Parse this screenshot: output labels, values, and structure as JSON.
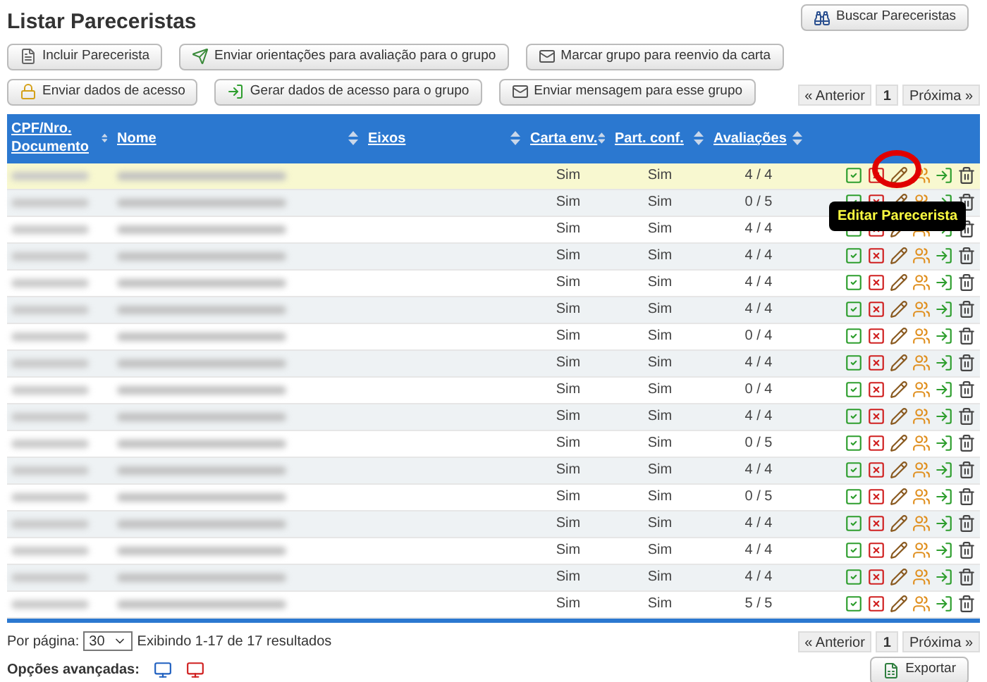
{
  "title": "Listar Pareceristas",
  "search_button": "Buscar Pareceristas",
  "toolbar_rows": [
    [
      {
        "label": "Incluir Parecerista",
        "kind": "page"
      },
      {
        "label": "Enviar orientações para avaliação para o grupo",
        "kind": "send"
      },
      {
        "label": "Marcar grupo para reenvio da carta",
        "kind": "mail"
      }
    ],
    [
      {
        "label": "Enviar dados de acesso",
        "kind": "lock"
      },
      {
        "label": "Gerar dados de acesso para o grupo",
        "kind": "arrow"
      },
      {
        "label": "Enviar mensagem para esse grupo",
        "kind": "mail"
      }
    ]
  ],
  "pagination_top": {
    "prev": "« Anterior",
    "page": "1",
    "next": "Próxima »"
  },
  "table": {
    "columns": [
      {
        "label": "CPF/Nro. Documento"
      },
      {
        "label": "Nome"
      },
      {
        "label": "Eixos"
      },
      {
        "label": "Carta env."
      },
      {
        "label": "Part. conf."
      },
      {
        "label": "Avaliações"
      }
    ],
    "rows": [
      {
        "carta": "Sim",
        "part": "Sim",
        "avaliacoes": "4 / 4",
        "selected": true
      },
      {
        "carta": "Sim",
        "part": "Sim",
        "avaliacoes": "0 / 5",
        "selected": false
      },
      {
        "carta": "Sim",
        "part": "Sim",
        "avaliacoes": "4 / 4",
        "selected": false
      },
      {
        "carta": "Sim",
        "part": "Sim",
        "avaliacoes": "4 / 4",
        "selected": false
      },
      {
        "carta": "Sim",
        "part": "Sim",
        "avaliacoes": "4 / 4",
        "selected": false
      },
      {
        "carta": "Sim",
        "part": "Sim",
        "avaliacoes": "4 / 4",
        "selected": false
      },
      {
        "carta": "Sim",
        "part": "Sim",
        "avaliacoes": "0 / 4",
        "selected": false
      },
      {
        "carta": "Sim",
        "part": "Sim",
        "avaliacoes": "4 / 4",
        "selected": false
      },
      {
        "carta": "Sim",
        "part": "Sim",
        "avaliacoes": "0 / 4",
        "selected": false
      },
      {
        "carta": "Sim",
        "part": "Sim",
        "avaliacoes": "4 / 4",
        "selected": false
      },
      {
        "carta": "Sim",
        "part": "Sim",
        "avaliacoes": "0 / 5",
        "selected": false
      },
      {
        "carta": "Sim",
        "part": "Sim",
        "avaliacoes": "4 / 4",
        "selected": false
      },
      {
        "carta": "Sim",
        "part": "Sim",
        "avaliacoes": "0 / 5",
        "selected": false
      },
      {
        "carta": "Sim",
        "part": "Sim",
        "avaliacoes": "4 / 4",
        "selected": false
      },
      {
        "carta": "Sim",
        "part": "Sim",
        "avaliacoes": "4 / 4",
        "selected": false
      },
      {
        "carta": "Sim",
        "part": "Sim",
        "avaliacoes": "4 / 4",
        "selected": false
      },
      {
        "carta": "Sim",
        "part": "Sim",
        "avaliacoes": "5 / 5",
        "selected": false
      }
    ]
  },
  "tooltip": "Editar Parecerista",
  "footer": {
    "per_page_label": "Por página:",
    "per_page_value": "30",
    "summary": "Exibindo 1-17 de 17 resultados",
    "advanced_label": "Opções avançadas:",
    "export_button": "Exportar"
  },
  "pagination_bottom": {
    "prev": "« Anterior",
    "page": "1",
    "next": "Próxima »"
  }
}
